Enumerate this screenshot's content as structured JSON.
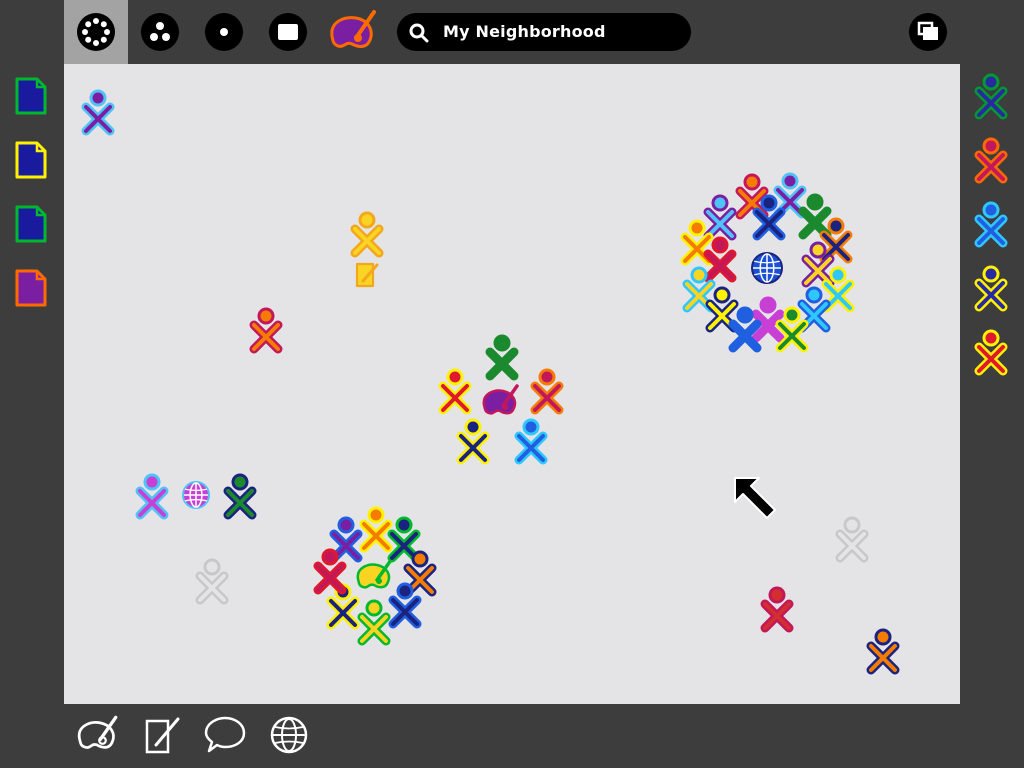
{
  "toolbar": {
    "views": [
      {
        "name": "neighborhood-view",
        "icon": "neighborhood-icon",
        "active": true
      },
      {
        "name": "group-view",
        "icon": "group-icon",
        "active": false
      },
      {
        "name": "home-view",
        "icon": "home-icon",
        "active": false
      },
      {
        "name": "activity-view",
        "icon": "activity-icon",
        "active": false
      },
      {
        "name": "paint-activity",
        "icon": "paint-icon",
        "active": false
      }
    ],
    "search": {
      "label": "My Neighborhood",
      "icon": "search-icon"
    },
    "frame_toggle_icon": "frame-toggle-icon"
  },
  "palette": {
    "black": "#000000",
    "white": "#ffffff",
    "active_bg": "#a3a3a3",
    "frame_bg": "#3d3d3d",
    "canvas_bg": "#e4e4e7",
    "inactive_buddy": "#c8c8c8"
  },
  "clipboard": [
    {
      "icon": "document-icon",
      "stroke": "#00b82e",
      "fill": "#1a1a9e"
    },
    {
      "icon": "document-icon",
      "stroke": "#fff200",
      "fill": "#1a1a9e"
    },
    {
      "icon": "document-icon",
      "stroke": "#00b82e",
      "fill": "#1a1a9e"
    },
    {
      "icon": "document-icon",
      "stroke": "#ff6a00",
      "fill": "#7a1fa2"
    }
  ],
  "friends": [
    {
      "icon": "buddy-icon",
      "stroke": "#009a2e",
      "fill": "#2a2aa0"
    },
    {
      "icon": "buddy-icon",
      "stroke": "#ff6a00",
      "fill": "#c2185b"
    },
    {
      "icon": "buddy-icon",
      "stroke": "#2ec7ff",
      "fill": "#1f5fe0"
    },
    {
      "icon": "buddy-icon",
      "stroke": "#fff200",
      "fill": "#2a2aa0"
    },
    {
      "icon": "buddy-icon",
      "stroke": "#fff200",
      "fill": "#e0182d"
    }
  ],
  "bottom_tray": [
    {
      "icon": "paint-icon"
    },
    {
      "icon": "write-icon"
    },
    {
      "icon": "chat-icon"
    },
    {
      "icon": "browse-icon"
    }
  ],
  "neighborhood": {
    "buddies": [
      {
        "stroke": "#4fc3f7",
        "fill": "#7b1fa2"
      },
      {
        "stroke": "#f4a71d",
        "fill": "#f9d423"
      },
      {
        "stroke": "#c2185b",
        "fill": "#f57c00"
      },
      {
        "stroke": "#4fc3f7",
        "fill": "#c83fd6"
      },
      {
        "stroke": "#1a237e",
        "fill": "#1b8a2e"
      },
      {
        "stroke": "#b0b0b0",
        "fill": "#e4e4e7"
      },
      {
        "stroke": "#d0d0d0",
        "fill": "#e4e4e7"
      },
      {
        "stroke": "#c2185b",
        "fill": "#d32f2f"
      },
      {
        "stroke": "#1a237e",
        "fill": "#f57c00"
      }
    ],
    "activity_groups": [
      {
        "activity": "paint-activity",
        "icon": "paint-icon",
        "members": 5
      },
      {
        "activity": "paint-activity",
        "icon": "paint-icon",
        "members": 9
      },
      {
        "activity": "browse-activity",
        "icon": "browse-icon",
        "members": 2
      },
      {
        "activity": "browse-activity",
        "icon": "browse-icon",
        "members": 15
      },
      {
        "activity": "write-activity",
        "icon": "write-icon",
        "members": 1
      }
    ],
    "cursor_icon": "pointer-arrow-icon"
  }
}
